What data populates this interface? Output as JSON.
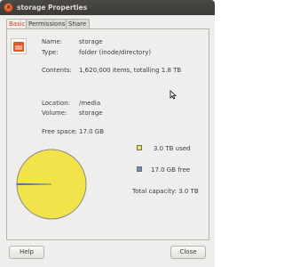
{
  "window": {
    "title": "storage Properties"
  },
  "tabs": [
    {
      "label": "Basic",
      "active": true
    },
    {
      "label": "Permissions",
      "active": false
    },
    {
      "label": "Share",
      "active": false
    }
  ],
  "basic": {
    "name_label": "Name:",
    "name_value": "storage",
    "type_label": "Type:",
    "type_value": "folder (inode/directory)",
    "contents_label": "Contents:",
    "contents_value": "1,620,000 items, totalling 1.8 TB",
    "location_label": "Location:",
    "location_value": "/media",
    "volume_label": "Volume:",
    "volume_value": "storage",
    "freespace_label": "Free space:",
    "freespace_value": "17.0 GB"
  },
  "disk_usage": {
    "used_label": "3.0 TB used",
    "free_label": "17.0 GB free",
    "total_label": "Total capacity: 3.0 TB",
    "used_color": "#f2e34a",
    "free_color": "#6d8fc4",
    "free_fraction": 0.0055
  },
  "buttons": {
    "help": "Help",
    "close": "Close"
  }
}
